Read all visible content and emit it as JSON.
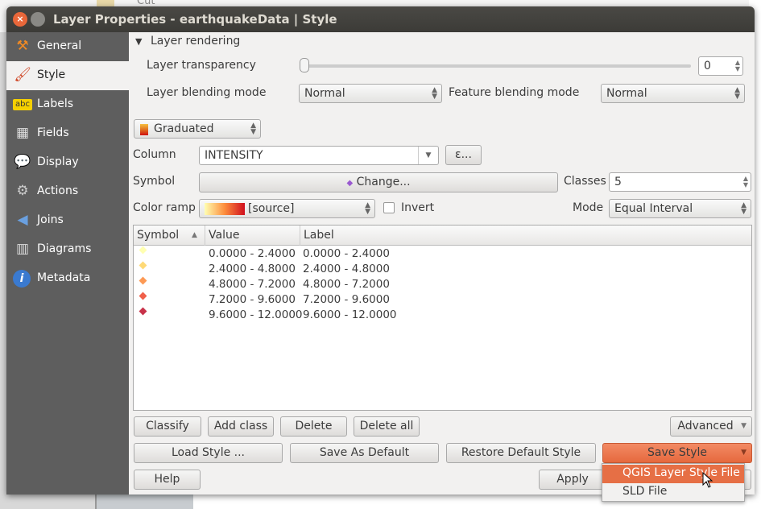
{
  "background": {
    "menu_item": "Cut"
  },
  "window": {
    "title": "Layer Properties - earthquakeData | Style",
    "close_icon": "×"
  },
  "sidebar": {
    "items": [
      {
        "label": "General",
        "icon": "⚒"
      },
      {
        "label": "Style",
        "icon": "🖌"
      },
      {
        "label": "Labels",
        "icon": "abc"
      },
      {
        "label": "Fields",
        "icon": "▦"
      },
      {
        "label": "Display",
        "icon": "💬"
      },
      {
        "label": "Actions",
        "icon": "⚙"
      },
      {
        "label": "Joins",
        "icon": "◀"
      },
      {
        "label": "Diagrams",
        "icon": "▥"
      },
      {
        "label": "Metadata",
        "icon": "i"
      }
    ],
    "selected": "Style"
  },
  "rendering": {
    "section_title": "Layer rendering",
    "transparency_label": "Layer transparency",
    "transparency_value": "0",
    "layer_blend_label": "Layer blending mode",
    "layer_blend_value": "Normal",
    "feature_blend_label": "Feature blending mode",
    "feature_blend_value": "Normal"
  },
  "renderer": {
    "type": "Graduated",
    "column_label": "Column",
    "column_value": "INTENSITY",
    "expression_button": "ε...",
    "symbol_label": "Symbol",
    "symbol_button": "Change...",
    "classes_label": "Classes",
    "classes_value": "5",
    "ramp_label": "Color ramp",
    "ramp_value": "[source]",
    "invert_label": "Invert",
    "invert_checked": false,
    "mode_label": "Mode",
    "mode_value": "Equal Interval"
  },
  "table": {
    "headers": [
      "Symbol",
      "Value",
      "Label"
    ],
    "rows": [
      {
        "color": "#ffffb2",
        "value": "0.0000 - 2.4000",
        "label": "0.0000 - 2.4000"
      },
      {
        "color": "#fed976",
        "value": "2.4000 - 4.8000",
        "label": "2.4000 - 4.8000"
      },
      {
        "color": "#fd9a55",
        "value": "4.8000 - 7.2000",
        "label": "4.8000 - 7.2000"
      },
      {
        "color": "#f0604a",
        "value": "7.2000 - 9.6000",
        "label": "7.2000 - 9.6000"
      },
      {
        "color": "#c8324a",
        "value": "9.6000 - 12.0000",
        "label": "9.6000 - 12.0000"
      }
    ]
  },
  "buttons": {
    "classify": "Classify",
    "add_class": "Add class",
    "delete": "Delete",
    "delete_all": "Delete all",
    "advanced": "Advanced",
    "load_style": "Load Style ...",
    "save_default": "Save As Default",
    "restore_default": "Restore Default Style",
    "save_style": "Save Style",
    "help": "Help",
    "apply": "Apply"
  },
  "save_menu": {
    "items": [
      "QGIS Layer Style File",
      "SLD File"
    ],
    "highlighted": "QGIS Layer Style File"
  },
  "colors": {
    "accent": "#e66f45",
    "titlebar": "#3c3b37",
    "sidebar": "#5e5e5e"
  }
}
